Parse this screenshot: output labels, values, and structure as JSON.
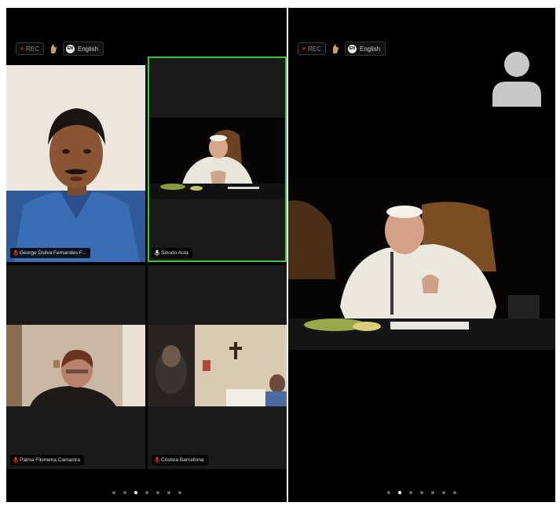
{
  "toolbar": {
    "rec_label": "REC",
    "language_code": "EN",
    "language_label": "English"
  },
  "gallery": {
    "tiles": [
      {
        "name": "George Dsilva Fernandes F...",
        "active": false
      },
      {
        "name": "Sinodo Aula",
        "active": true
      },
      {
        "name": "Palma Filomena Camastra",
        "active": false
      },
      {
        "name": "Cristina Barcellona",
        "active": false
      }
    ],
    "page_dots": 7,
    "active_dot": 2
  },
  "speaker": {
    "page_dots": 7,
    "active_dot": 1
  },
  "colors": {
    "active_border": "#35c93a",
    "background": "#000000",
    "muted_icon": "#e0352b"
  }
}
